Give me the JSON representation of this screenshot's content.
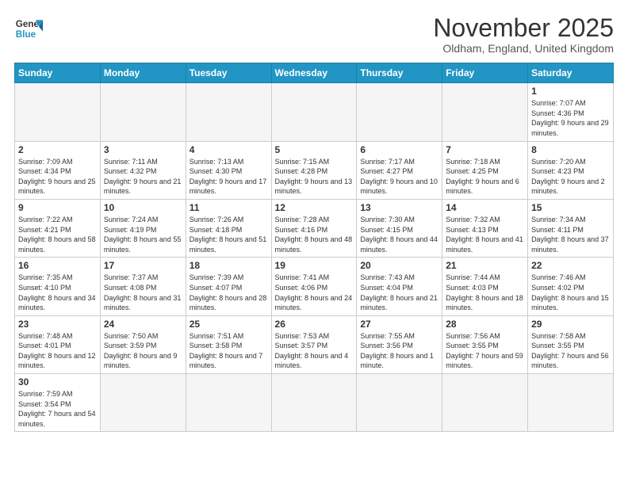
{
  "header": {
    "logo_general": "General",
    "logo_blue": "Blue",
    "title": "November 2025",
    "subtitle": "Oldham, England, United Kingdom"
  },
  "weekdays": [
    "Sunday",
    "Monday",
    "Tuesday",
    "Wednesday",
    "Thursday",
    "Friday",
    "Saturday"
  ],
  "weeks": [
    [
      {
        "day": "",
        "empty": true
      },
      {
        "day": "",
        "empty": true
      },
      {
        "day": "",
        "empty": true
      },
      {
        "day": "",
        "empty": true
      },
      {
        "day": "",
        "empty": true
      },
      {
        "day": "",
        "empty": true
      },
      {
        "day": "1",
        "info": "Sunrise: 7:07 AM\nSunset: 4:36 PM\nDaylight: 9 hours\nand 29 minutes."
      }
    ],
    [
      {
        "day": "2",
        "info": "Sunrise: 7:09 AM\nSunset: 4:34 PM\nDaylight: 9 hours\nand 25 minutes."
      },
      {
        "day": "3",
        "info": "Sunrise: 7:11 AM\nSunset: 4:32 PM\nDaylight: 9 hours\nand 21 minutes."
      },
      {
        "day": "4",
        "info": "Sunrise: 7:13 AM\nSunset: 4:30 PM\nDaylight: 9 hours\nand 17 minutes."
      },
      {
        "day": "5",
        "info": "Sunrise: 7:15 AM\nSunset: 4:28 PM\nDaylight: 9 hours\nand 13 minutes."
      },
      {
        "day": "6",
        "info": "Sunrise: 7:17 AM\nSunset: 4:27 PM\nDaylight: 9 hours\nand 10 minutes."
      },
      {
        "day": "7",
        "info": "Sunrise: 7:18 AM\nSunset: 4:25 PM\nDaylight: 9 hours\nand 6 minutes."
      },
      {
        "day": "8",
        "info": "Sunrise: 7:20 AM\nSunset: 4:23 PM\nDaylight: 9 hours\nand 2 minutes."
      }
    ],
    [
      {
        "day": "9",
        "info": "Sunrise: 7:22 AM\nSunset: 4:21 PM\nDaylight: 8 hours\nand 58 minutes."
      },
      {
        "day": "10",
        "info": "Sunrise: 7:24 AM\nSunset: 4:19 PM\nDaylight: 8 hours\nand 55 minutes."
      },
      {
        "day": "11",
        "info": "Sunrise: 7:26 AM\nSunset: 4:18 PM\nDaylight: 8 hours\nand 51 minutes."
      },
      {
        "day": "12",
        "info": "Sunrise: 7:28 AM\nSunset: 4:16 PM\nDaylight: 8 hours\nand 48 minutes."
      },
      {
        "day": "13",
        "info": "Sunrise: 7:30 AM\nSunset: 4:15 PM\nDaylight: 8 hours\nand 44 minutes."
      },
      {
        "day": "14",
        "info": "Sunrise: 7:32 AM\nSunset: 4:13 PM\nDaylight: 8 hours\nand 41 minutes."
      },
      {
        "day": "15",
        "info": "Sunrise: 7:34 AM\nSunset: 4:11 PM\nDaylight: 8 hours\nand 37 minutes."
      }
    ],
    [
      {
        "day": "16",
        "info": "Sunrise: 7:35 AM\nSunset: 4:10 PM\nDaylight: 8 hours\nand 34 minutes."
      },
      {
        "day": "17",
        "info": "Sunrise: 7:37 AM\nSunset: 4:08 PM\nDaylight: 8 hours\nand 31 minutes."
      },
      {
        "day": "18",
        "info": "Sunrise: 7:39 AM\nSunset: 4:07 PM\nDaylight: 8 hours\nand 28 minutes."
      },
      {
        "day": "19",
        "info": "Sunrise: 7:41 AM\nSunset: 4:06 PM\nDaylight: 8 hours\nand 24 minutes."
      },
      {
        "day": "20",
        "info": "Sunrise: 7:43 AM\nSunset: 4:04 PM\nDaylight: 8 hours\nand 21 minutes."
      },
      {
        "day": "21",
        "info": "Sunrise: 7:44 AM\nSunset: 4:03 PM\nDaylight: 8 hours\nand 18 minutes."
      },
      {
        "day": "22",
        "info": "Sunrise: 7:46 AM\nSunset: 4:02 PM\nDaylight: 8 hours\nand 15 minutes."
      }
    ],
    [
      {
        "day": "23",
        "info": "Sunrise: 7:48 AM\nSunset: 4:01 PM\nDaylight: 8 hours\nand 12 minutes."
      },
      {
        "day": "24",
        "info": "Sunrise: 7:50 AM\nSunset: 3:59 PM\nDaylight: 8 hours\nand 9 minutes."
      },
      {
        "day": "25",
        "info": "Sunrise: 7:51 AM\nSunset: 3:58 PM\nDaylight: 8 hours\nand 7 minutes."
      },
      {
        "day": "26",
        "info": "Sunrise: 7:53 AM\nSunset: 3:57 PM\nDaylight: 8 hours\nand 4 minutes."
      },
      {
        "day": "27",
        "info": "Sunrise: 7:55 AM\nSunset: 3:56 PM\nDaylight: 8 hours\nand 1 minute."
      },
      {
        "day": "28",
        "info": "Sunrise: 7:56 AM\nSunset: 3:55 PM\nDaylight: 7 hours\nand 59 minutes."
      },
      {
        "day": "29",
        "info": "Sunrise: 7:58 AM\nSunset: 3:55 PM\nDaylight: 7 hours\nand 56 minutes."
      }
    ],
    [
      {
        "day": "30",
        "info": "Sunrise: 7:59 AM\nSunset: 3:54 PM\nDaylight: 7 hours\nand 54 minutes."
      },
      {
        "day": "",
        "empty": true
      },
      {
        "day": "",
        "empty": true
      },
      {
        "day": "",
        "empty": true
      },
      {
        "day": "",
        "empty": true
      },
      {
        "day": "",
        "empty": true
      },
      {
        "day": "",
        "empty": true
      }
    ]
  ]
}
